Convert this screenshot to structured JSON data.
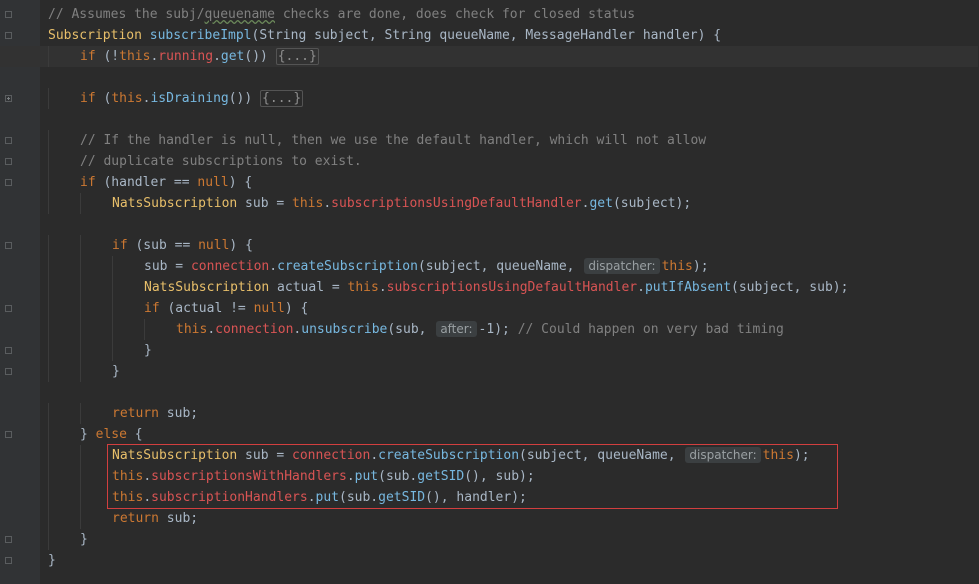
{
  "editor": {
    "lines": [
      {
        "indent": 0,
        "fold": "minus",
        "tokens": [
          {
            "t": "// Assumes the subj/",
            "c": "cmt"
          },
          {
            "t": "queuename",
            "c": "cmt sq"
          },
          {
            "t": " checks are done, does check for closed status",
            "c": "cmt"
          }
        ]
      },
      {
        "indent": 0,
        "fold": "minus",
        "tokens": [
          {
            "t": "Subscription ",
            "c": "cls"
          },
          {
            "t": "subscribeImpl",
            "c": "mc"
          },
          {
            "t": "(String subject, String queueName, MessageHandler handler) {",
            "c": ""
          }
        ]
      },
      {
        "indent": 1,
        "fold": "plus",
        "current": true,
        "bulb": true,
        "tokens": [
          {
            "t": "if",
            "c": "kw"
          },
          {
            "t": " (!",
            "c": ""
          },
          {
            "t": "this",
            "c": "kw"
          },
          {
            "t": ".",
            "c": ""
          },
          {
            "t": "running",
            "c": "fld"
          },
          {
            "t": ".",
            "c": ""
          },
          {
            "t": "get",
            "c": "mc"
          },
          {
            "t": "()) ",
            "c": ""
          },
          {
            "t": "{...}",
            "c": "fold-text"
          }
        ]
      },
      {
        "indent": 0,
        "tokens": []
      },
      {
        "indent": 1,
        "fold": "plus",
        "tokens": [
          {
            "t": "if",
            "c": "kw"
          },
          {
            "t": " (",
            "c": ""
          },
          {
            "t": "this",
            "c": "kw"
          },
          {
            "t": ".",
            "c": ""
          },
          {
            "t": "isDraining",
            "c": "mc"
          },
          {
            "t": "()) ",
            "c": ""
          },
          {
            "t": "{...}",
            "c": "fold-text"
          }
        ]
      },
      {
        "indent": 0,
        "tokens": []
      },
      {
        "indent": 1,
        "fold": "minus",
        "tokens": [
          {
            "t": "// If the handler is null, then we use the default handler, which will not allow",
            "c": "cmt"
          }
        ]
      },
      {
        "indent": 1,
        "fold": "minus",
        "tokens": [
          {
            "t": "// duplicate subscriptions to exist.",
            "c": "cmt"
          }
        ]
      },
      {
        "indent": 1,
        "fold": "minus",
        "tokens": [
          {
            "t": "if",
            "c": "kw"
          },
          {
            "t": " (handler == ",
            "c": ""
          },
          {
            "t": "null",
            "c": "kw"
          },
          {
            "t": ") {",
            "c": ""
          }
        ]
      },
      {
        "indent": 2,
        "tokens": [
          {
            "t": "NatsSubscription",
            "c": "cls"
          },
          {
            "t": " sub = ",
            "c": ""
          },
          {
            "t": "this",
            "c": "kw"
          },
          {
            "t": ".",
            "c": ""
          },
          {
            "t": "subscriptionsUsingDefaultHandler",
            "c": "fld"
          },
          {
            "t": ".",
            "c": ""
          },
          {
            "t": "get",
            "c": "mc"
          },
          {
            "t": "(subject);",
            "c": ""
          }
        ]
      },
      {
        "indent": 0,
        "tokens": []
      },
      {
        "indent": 2,
        "fold": "minus",
        "tokens": [
          {
            "t": "if",
            "c": "kw"
          },
          {
            "t": " (sub == ",
            "c": ""
          },
          {
            "t": "null",
            "c": "kw"
          },
          {
            "t": ") {",
            "c": ""
          }
        ]
      },
      {
        "indent": 3,
        "tokens": [
          {
            "t": "sub = ",
            "c": ""
          },
          {
            "t": "connection",
            "c": "fld"
          },
          {
            "t": ".",
            "c": ""
          },
          {
            "t": "createSubscription",
            "c": "mc"
          },
          {
            "t": "(subject, queueName, ",
            "c": ""
          },
          {
            "t": "dispatcher:",
            "c": "hint"
          },
          {
            "t": "this",
            "c": "kw"
          },
          {
            "t": ");",
            "c": ""
          }
        ]
      },
      {
        "indent": 3,
        "tokens": [
          {
            "t": "NatsSubscription",
            "c": "cls"
          },
          {
            "t": " actual = ",
            "c": ""
          },
          {
            "t": "this",
            "c": "kw"
          },
          {
            "t": ".",
            "c": ""
          },
          {
            "t": "subscriptionsUsingDefaultHandler",
            "c": "fld"
          },
          {
            "t": ".",
            "c": ""
          },
          {
            "t": "putIfAbsent",
            "c": "mc"
          },
          {
            "t": "(subject, sub);",
            "c": ""
          }
        ]
      },
      {
        "indent": 3,
        "fold": "minus",
        "tokens": [
          {
            "t": "if",
            "c": "kw"
          },
          {
            "t": " (actual != ",
            "c": ""
          },
          {
            "t": "null",
            "c": "kw"
          },
          {
            "t": ") {",
            "c": ""
          }
        ]
      },
      {
        "indent": 4,
        "tokens": [
          {
            "t": "this",
            "c": "kw"
          },
          {
            "t": ".",
            "c": ""
          },
          {
            "t": "connection",
            "c": "fld"
          },
          {
            "t": ".",
            "c": ""
          },
          {
            "t": "unsubscribe",
            "c": "mc"
          },
          {
            "t": "(sub, ",
            "c": ""
          },
          {
            "t": "after:",
            "c": "hint"
          },
          {
            "t": "-1); ",
            "c": ""
          },
          {
            "t": "// Could happen on very bad timing",
            "c": "cmt"
          }
        ]
      },
      {
        "indent": 3,
        "fold": "minus",
        "tokens": [
          {
            "t": "}",
            "c": ""
          }
        ]
      },
      {
        "indent": 2,
        "fold": "minus",
        "tokens": [
          {
            "t": "}",
            "c": ""
          }
        ]
      },
      {
        "indent": 0,
        "tokens": []
      },
      {
        "indent": 2,
        "tokens": [
          {
            "t": "return",
            "c": "kw"
          },
          {
            "t": " sub;",
            "c": ""
          }
        ]
      },
      {
        "indent": 1,
        "fold": "minus",
        "tokens": [
          {
            "t": "} ",
            "c": ""
          },
          {
            "t": "else",
            "c": "kw"
          },
          {
            "t": " {",
            "c": ""
          }
        ]
      },
      {
        "indent": 2,
        "tokens": [
          {
            "t": "NatsSubscription",
            "c": "cls"
          },
          {
            "t": " sub = ",
            "c": ""
          },
          {
            "t": "connection",
            "c": "fld"
          },
          {
            "t": ".",
            "c": ""
          },
          {
            "t": "createSubscription",
            "c": "mc"
          },
          {
            "t": "(subject, queueName, ",
            "c": ""
          },
          {
            "t": "dispatcher:",
            "c": "hint"
          },
          {
            "t": "this",
            "c": "kw"
          },
          {
            "t": ");",
            "c": ""
          }
        ]
      },
      {
        "indent": 2,
        "tokens": [
          {
            "t": "this",
            "c": "kw"
          },
          {
            "t": ".",
            "c": ""
          },
          {
            "t": "subscriptionsWithHandlers",
            "c": "fld"
          },
          {
            "t": ".",
            "c": ""
          },
          {
            "t": "put",
            "c": "mc"
          },
          {
            "t": "(sub.",
            "c": ""
          },
          {
            "t": "getSID",
            "c": "mc"
          },
          {
            "t": "(), sub);",
            "c": ""
          }
        ]
      },
      {
        "indent": 2,
        "tokens": [
          {
            "t": "this",
            "c": "kw"
          },
          {
            "t": ".",
            "c": ""
          },
          {
            "t": "subscriptionHandlers",
            "c": "fld"
          },
          {
            "t": ".",
            "c": ""
          },
          {
            "t": "put",
            "c": "mc"
          },
          {
            "t": "(sub.",
            "c": ""
          },
          {
            "t": "getSID",
            "c": "mc"
          },
          {
            "t": "(), handler);",
            "c": ""
          }
        ]
      },
      {
        "indent": 2,
        "tokens": [
          {
            "t": "return",
            "c": "kw"
          },
          {
            "t": " sub;",
            "c": ""
          }
        ]
      },
      {
        "indent": 1,
        "fold": "minus",
        "tokens": [
          {
            "t": "}",
            "c": ""
          }
        ]
      },
      {
        "indent": 0,
        "fold": "minus",
        "tokens": [
          {
            "t": "}",
            "c": ""
          }
        ]
      }
    ]
  },
  "colors": {
    "background": "#2b2b2b",
    "gutter": "#313335",
    "keyword": "#cc7832",
    "field": "#d95454",
    "method": "#77b8e0",
    "class": "#e8bf6a",
    "comment": "#808080",
    "highlight_box": "#d23f3f"
  }
}
